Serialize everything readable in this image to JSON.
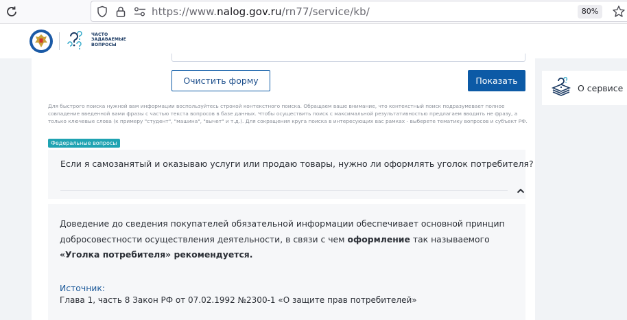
{
  "browser": {
    "url_prefix": "https://www.",
    "url_domain": "nalog.gov.ru",
    "url_path": "/rn77/service/kb/",
    "zoom": "80%"
  },
  "header": {
    "faq_line1": "ЧАСТО",
    "faq_line2": "ЗАДАВАЕМЫЕ",
    "faq_line3": "ВОПРОСЫ"
  },
  "form": {
    "clear_label": "Очистить форму",
    "show_label": "Показать",
    "hint": "Для быстрого поиска нужной вам информации воспользуйтесь строкой контекстного поиска. Обращаем ваше внимание, что контекстный поиск подразумевает полное совпадение введенной вами фразы с частью текста вопросов в базе данных. Чтобы осуществить поиск с максимальной результативностью предлагаем вводить не фразу, а только ключевые слова (к примеру \"студент\", \"машина\", \"вычет\" и т.д.). Для сокращения круга поиска в интересующих вас рамках - выберете тематику вопросов и субъект РФ."
  },
  "tag": "Федеральные вопросы",
  "question": "Если я самозанятый и оказываю услуги или продаю товары, нужно ли оформлять уголок потребителя?",
  "answer": {
    "part1": "Доведение до сведения покупателей обязательной информации обеспечивает основной принцип добросовестности осуществления деятельности, в связи с чем ",
    "bold1": "оформление",
    "part2": " так называемого ",
    "bold2": "«Уголка потребителя» рекомендуется.",
    "source_label": "Источник:",
    "source_text": "Глава 1, часть 8 Закон РФ от 07.02.1992 №2300-1 «О защите прав потребителей»"
  },
  "sidebar": {
    "about_label": "О сервисе"
  },
  "colors": {
    "primary": "#0c5aa6",
    "tag": "#1fa3b2",
    "link": "#1d5a9a"
  }
}
